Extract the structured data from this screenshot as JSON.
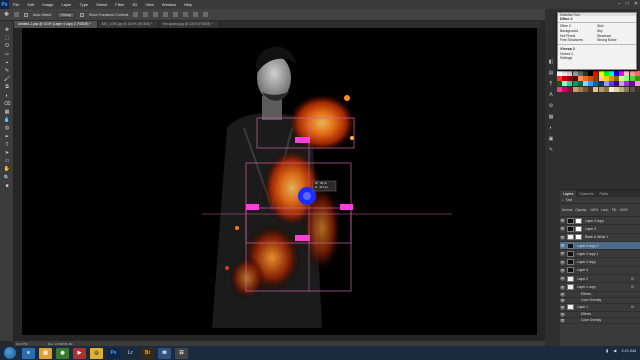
{
  "app": {
    "logo": "Ps"
  },
  "menu": [
    "File",
    "Edit",
    "Image",
    "Layer",
    "Type",
    "Select",
    "Filter",
    "3D",
    "View",
    "Window",
    "Help"
  ],
  "window_controls": [
    "–",
    "□",
    "✕"
  ],
  "options": {
    "auto_select_label": "Auto-Select:",
    "auto_select_value": "Group",
    "transform_label": "Show Transform Controls"
  },
  "tabs": [
    {
      "label": "Untitled-1.psd @ 101% (Layer 4 copy 2, RGB/8) *",
      "active": true
    },
    {
      "label": "IMG_1090.jpg @ 16.6% (RGB/8) *",
      "active": false
    },
    {
      "label": "fire-sparks.jpg @ 100% (RGB/8) *",
      "active": false
    }
  ],
  "tools": [
    "✥",
    "⬚",
    "ʘ",
    "✂",
    "⌖",
    "✎",
    "🖌",
    "⧉",
    "◐",
    "⌫",
    "▦",
    "💧",
    "◍",
    "✒",
    "T",
    "➤",
    "▭",
    "✋",
    "🔍",
    "■"
  ],
  "status": {
    "zoom": "101.07%",
    "doc": "Doc: 3.03M/35.2M"
  },
  "canvas": {
    "measure": "W : 49 px\nH : 127 px"
  },
  "popup": {
    "title": "Selective Tool",
    "heading": "Dfine 2",
    "grid": [
      "Dfine 2",
      "Skin",
      "Background",
      "Sky",
      "Hot Pixels",
      "Shadows",
      "Fine Structures",
      "Strong Noise"
    ],
    "section2": "Viveza 2",
    "rows": [
      "Viveza 2",
      "Settings"
    ]
  },
  "swatch_colors": [
    "#ffffff",
    "#e6e6e6",
    "#cccccc",
    "#999999",
    "#666666",
    "#333333",
    "#000000",
    "#ff0000",
    "#ffff00",
    "#00ff00",
    "#00ffff",
    "#0000ff",
    "#ff00ff",
    "#ffcccc",
    "#ff9999",
    "#ff6666",
    "#ff3333",
    "#cc0000",
    "#990000",
    "#660000",
    "#ff9966",
    "#ff6600",
    "#cc5200",
    "#993d00",
    "#ffcc99",
    "#ffcc00",
    "#cc9900",
    "#996600",
    "#ccff99",
    "#99ff66",
    "#66cc33",
    "#339900",
    "#006600",
    "#99ffcc",
    "#33cc99",
    "#009966",
    "#006644",
    "#99ccff",
    "#3399ff",
    "#0066cc",
    "#003399",
    "#9999ff",
    "#6633ff",
    "#330099",
    "#cc99ff",
    "#9933cc",
    "#660099",
    "#ff99cc",
    "#ff3399",
    "#cc0066",
    "#990033",
    "#c8a06e",
    "#a67c52",
    "#7a5230",
    "#4d3319",
    "#d9c59c",
    "#b39b66",
    "#8c7340",
    "#f5f0dc",
    "#e0d2a8",
    "#bfa97a",
    "#8a7a5a",
    "#5c5040",
    "#3c3328"
  ],
  "layers": {
    "tabs": [
      "Layers",
      "Channels",
      "Paths"
    ],
    "filter": "Kind",
    "blend": "Normal",
    "opacity_label": "Opacity:",
    "opacity": "100%",
    "lock_label": "Lock:",
    "fill_label": "Fill:",
    "fill": "100%",
    "rows": [
      {
        "name": "Layer 3 copy",
        "thumb": "black",
        "mask": true,
        "selected": false,
        "fx": false,
        "sub": false
      },
      {
        "name": "Layer 3",
        "thumb": "black",
        "mask": true,
        "selected": false,
        "fx": false,
        "sub": false
      },
      {
        "name": "Black & White 1",
        "thumb": "white",
        "mask": true,
        "selected": false,
        "fx": false,
        "sub": false
      },
      {
        "name": "Layer 4 copy 2",
        "thumb": "black",
        "mask": false,
        "selected": true,
        "fx": false,
        "sub": false
      },
      {
        "name": "Layer 4 copy 1",
        "thumb": "black",
        "mask": false,
        "selected": false,
        "fx": false,
        "sub": false
      },
      {
        "name": "Layer 4 copy",
        "thumb": "black",
        "mask": false,
        "selected": false,
        "fx": false,
        "sub": false
      },
      {
        "name": "Layer 4",
        "thumb": "black",
        "mask": false,
        "selected": false,
        "fx": false,
        "sub": false
      },
      {
        "name": "Layer 2",
        "thumb": "white",
        "mask": false,
        "selected": false,
        "fx": true,
        "sub": false
      },
      {
        "name": "Layer 1 copy",
        "thumb": "white",
        "mask": false,
        "selected": false,
        "fx": true,
        "sub": false
      },
      {
        "name": "Effects",
        "thumb": "",
        "mask": false,
        "selected": false,
        "fx": false,
        "sub": true
      },
      {
        "name": "Color Overlay",
        "thumb": "",
        "mask": false,
        "selected": false,
        "fx": false,
        "sub": true
      },
      {
        "name": "Layer 1",
        "thumb": "white",
        "mask": false,
        "selected": false,
        "fx": true,
        "sub": false
      },
      {
        "name": "Effects",
        "thumb": "",
        "mask": false,
        "selected": false,
        "fx": false,
        "sub": true
      },
      {
        "name": "Color Overlay",
        "thumb": "",
        "mask": false,
        "selected": false,
        "fx": false,
        "sub": true
      }
    ],
    "fx_label": "fx"
  },
  "taskbar": {
    "apps": [
      {
        "label": "e",
        "bg": "#2b6cb0",
        "fg": "#fff"
      },
      {
        "label": "▤",
        "bg": "#e0a030",
        "fg": "#fff"
      },
      {
        "label": "◉",
        "bg": "#3a7a2a",
        "fg": "#fff"
      },
      {
        "label": "▶",
        "bg": "#b03030",
        "fg": "#fff"
      },
      {
        "label": "◎",
        "bg": "#e0b030",
        "fg": "#333"
      },
      {
        "label": "Ps",
        "bg": "#10254a",
        "fg": "#31a8ff"
      },
      {
        "label": "Lr",
        "bg": "#1b2a3a",
        "fg": "#9ad"
      },
      {
        "label": "Br",
        "bg": "#3a2a10",
        "fg": "#e8a23a"
      },
      {
        "label": "✉",
        "bg": "#305080",
        "fg": "#fff"
      },
      {
        "label": "☷",
        "bg": "#444",
        "fg": "#fff"
      }
    ],
    "time": "2:21 AM"
  }
}
